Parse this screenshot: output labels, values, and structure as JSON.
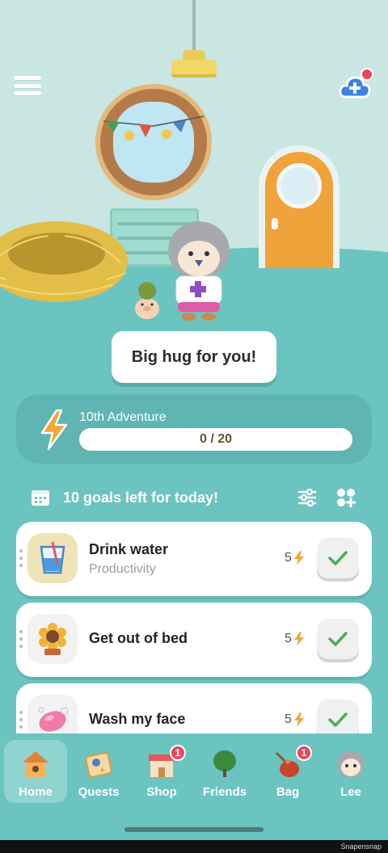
{
  "scene": {
    "speech": "Big hug for you!"
  },
  "adventure": {
    "title": "10th Adventure",
    "progress_text": "0 / 20",
    "progress_fraction": 0
  },
  "goals_header": {
    "text": "10 goals left for today!"
  },
  "goals": [
    {
      "name": "Drink water",
      "category": "Productivity",
      "points": "5",
      "icon": "water-glass-icon"
    },
    {
      "name": "Get out of bed",
      "category": "",
      "points": "5",
      "icon": "sunflower-icon"
    },
    {
      "name": "Wash my face",
      "category": "",
      "points": "5",
      "icon": "soap-icon"
    }
  ],
  "nav": {
    "items": [
      {
        "label": "Home",
        "icon": "birdhouse-icon",
        "badge": ""
      },
      {
        "label": "Quests",
        "icon": "quests-icon",
        "badge": ""
      },
      {
        "label": "Shop",
        "icon": "shop-icon",
        "badge": "1"
      },
      {
        "label": "Friends",
        "icon": "tree-icon",
        "badge": ""
      },
      {
        "label": "Bag",
        "icon": "bag-icon",
        "badge": "1"
      },
      {
        "label": "Lee",
        "icon": "avatar-icon",
        "badge": ""
      }
    ]
  },
  "watermark": "Snapensnap",
  "colors": {
    "background": "#6cc4c0",
    "accent": "#f3a73b",
    "check": "#4caf50",
    "badge": "#e8485c"
  }
}
